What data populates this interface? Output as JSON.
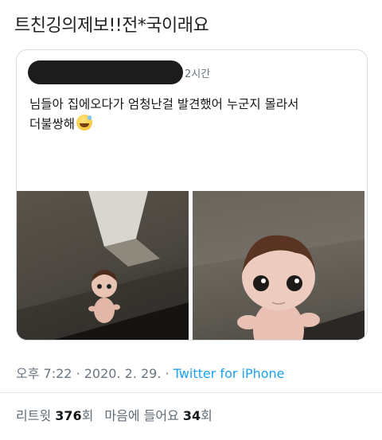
{
  "post": {
    "title": "트친깅의제보!!전*국이래요"
  },
  "quoted_tweet": {
    "time": "2시간",
    "text_line1": "님들아 집에오다가 엄청난걸 발견했어 누군지 몰라서",
    "text_line2": "더불쌍해",
    "emoji_icon": "grinning-sweat-emoji"
  },
  "tweet_meta": {
    "time": "오후 7:22",
    "separator": "·",
    "date": "2020. 2. 29.",
    "source": "Twitter for iPhone"
  },
  "stats": {
    "retweets_label": "리트윗",
    "retweets_count": "376",
    "retweets_unit": "회",
    "likes_label": "마음에 들어요",
    "likes_count": "34",
    "likes_unit": "회"
  },
  "colors": {
    "link": "#1da1f2",
    "muted": "#6a7580",
    "redaction": "#1c1c1c"
  }
}
